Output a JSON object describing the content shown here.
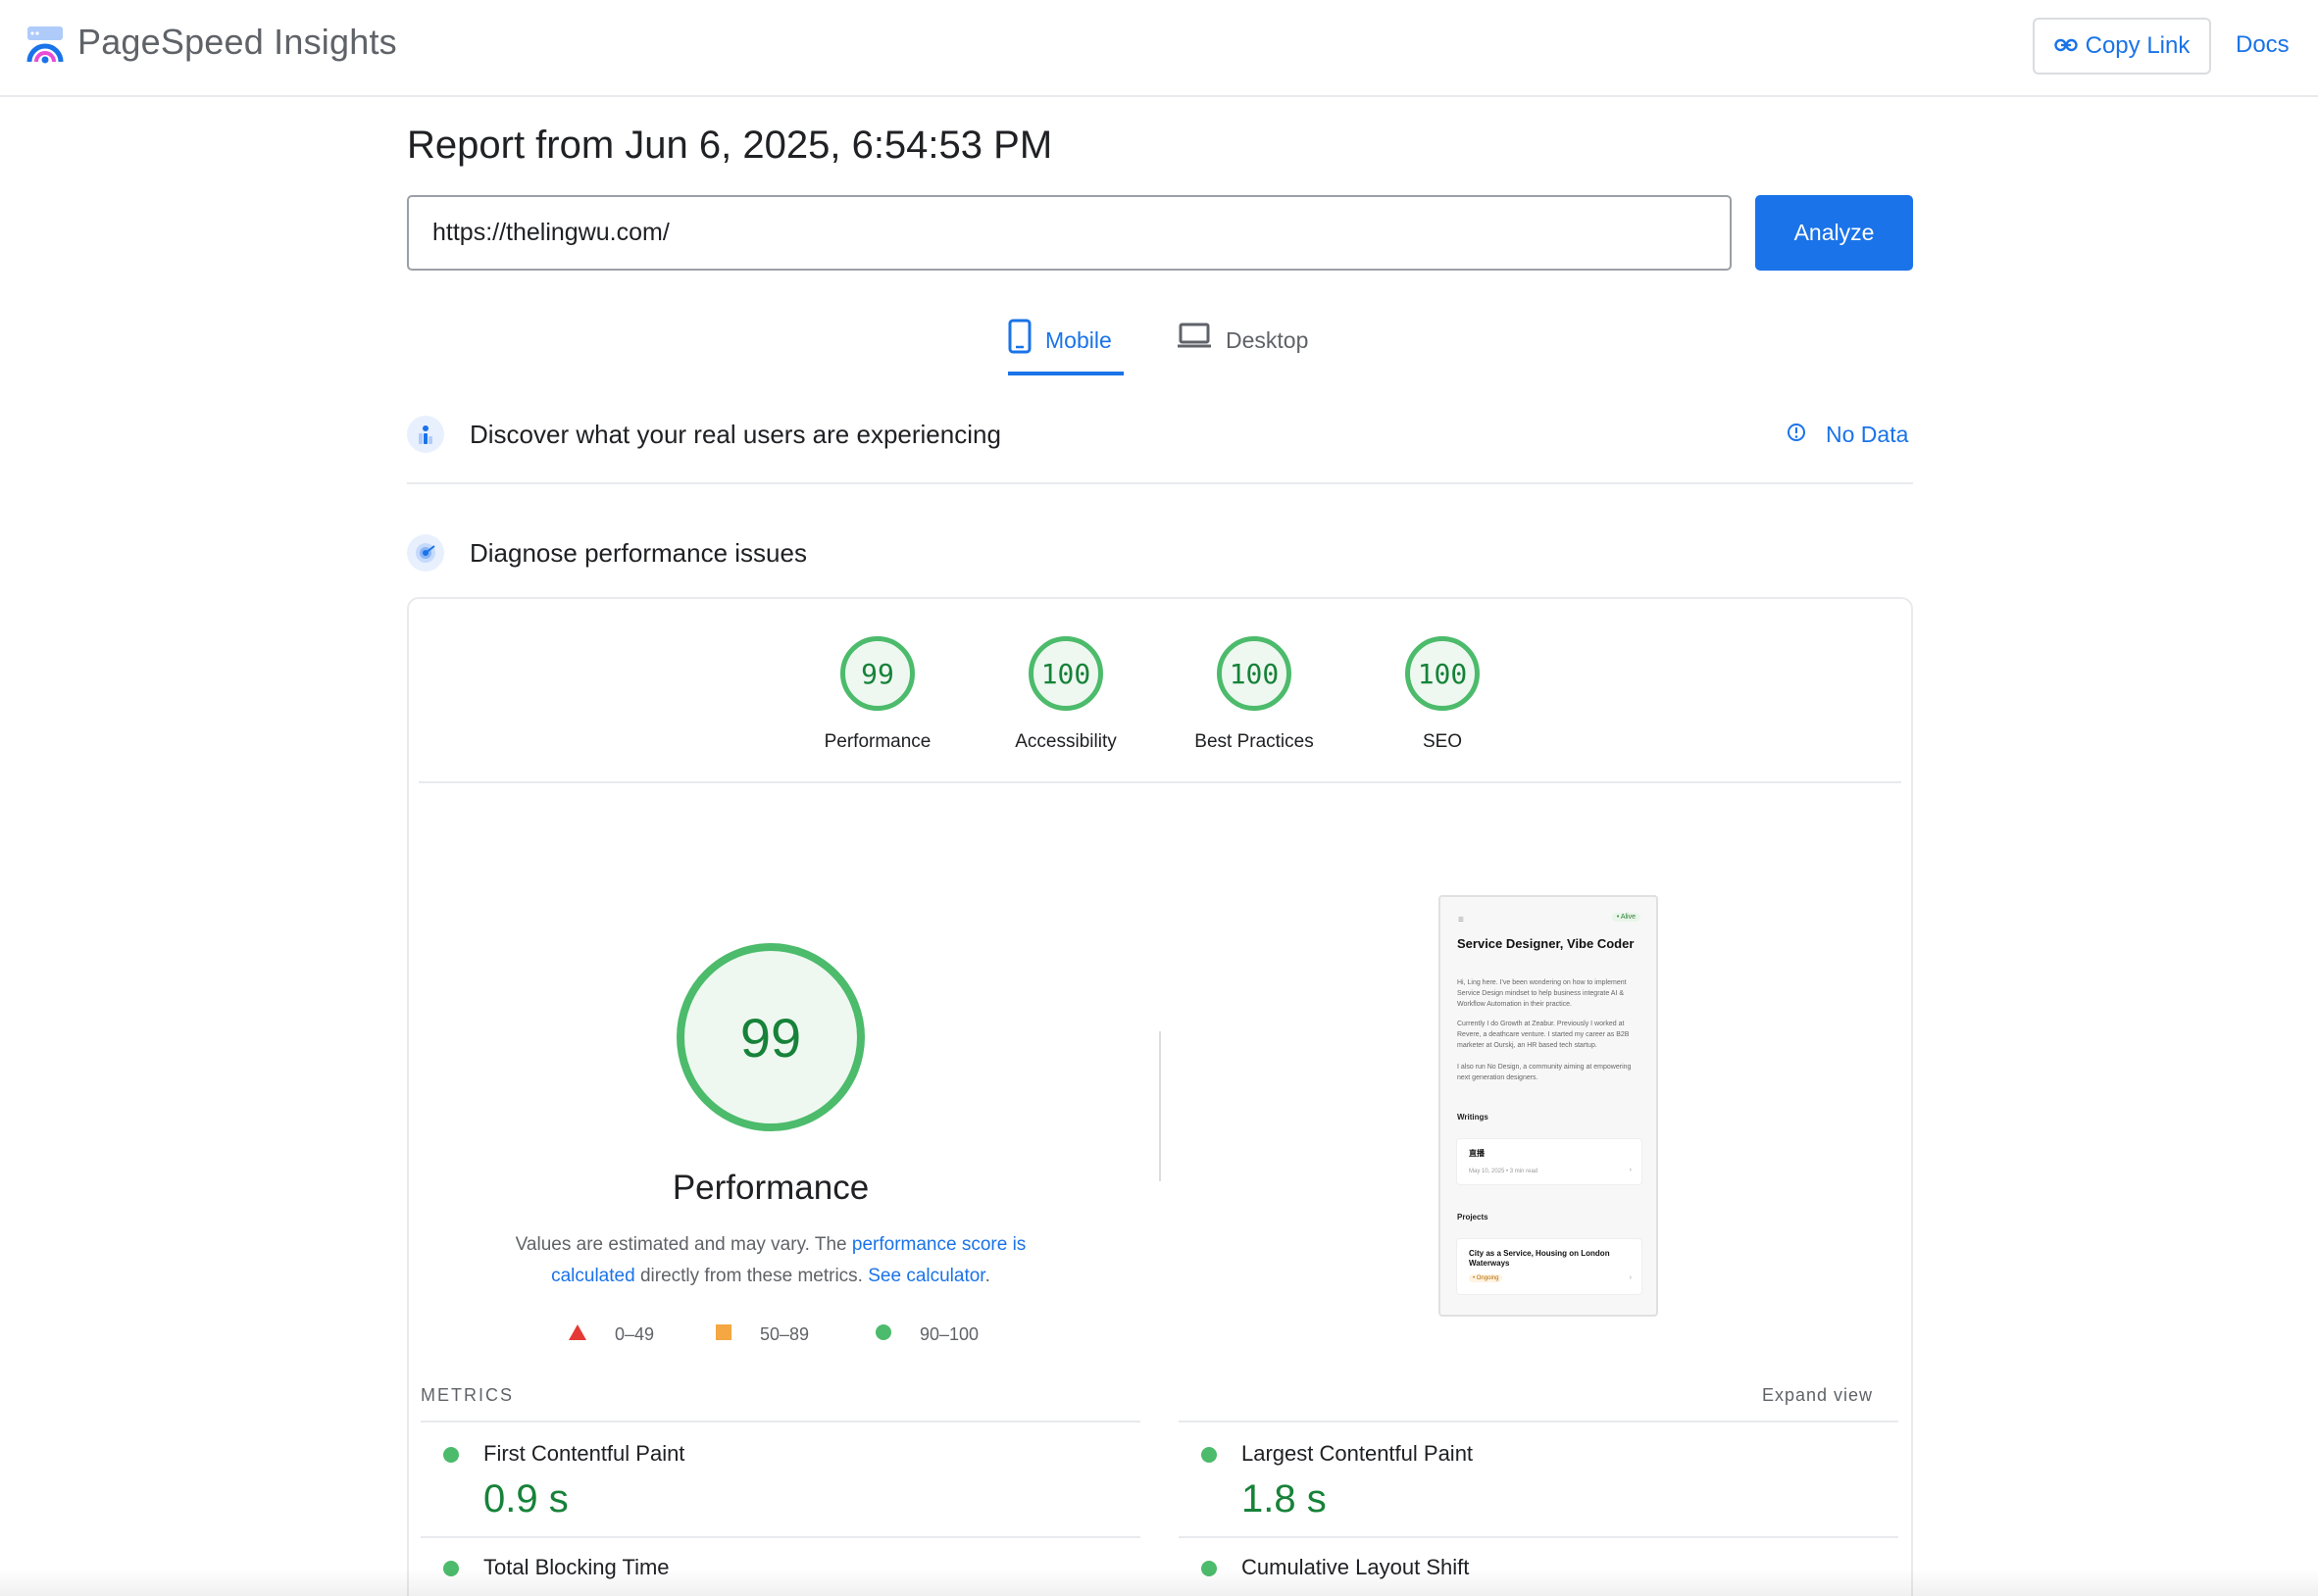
{
  "header": {
    "app_title": "PageSpeed Insights",
    "copy_link_label": "Copy Link",
    "docs_label": "Docs"
  },
  "report": {
    "title": "Report from Jun 6, 2025, 6:54:53 PM",
    "url_value": "https://thelingwu.com/",
    "analyze_label": "Analyze"
  },
  "tabs": [
    {
      "label": "Mobile",
      "active": true
    },
    {
      "label": "Desktop",
      "active": false
    }
  ],
  "sections": {
    "real_users_title": "Discover what your real users are experiencing",
    "no_data_label": "No Data",
    "diagnose_title": "Diagnose performance issues"
  },
  "scores": [
    {
      "value": "99",
      "label": "Performance"
    },
    {
      "value": "100",
      "label": "Accessibility"
    },
    {
      "value": "100",
      "label": "Best Practices"
    },
    {
      "value": "100",
      "label": "SEO"
    }
  ],
  "performance": {
    "score": "99",
    "title": "Performance",
    "desc_prefix": "Values are estimated and may vary. The ",
    "desc_link1": "performance score is calculated",
    "desc_middle": " directly from these metrics. ",
    "desc_link2": "See calculator",
    "desc_suffix": ".",
    "legend": [
      {
        "range": "0–49",
        "color": "#e53935"
      },
      {
        "range": "50–89",
        "color": "#f4a742"
      },
      {
        "range": "90–100",
        "color": "#4cbb6b"
      }
    ]
  },
  "thumbnail": {
    "badge": "• Alive",
    "title": "Service Designer, Vibe Coder",
    "para1": "Hi, Ling here. I've been wondering on how to implement Service Design mindset to help business integrate AI & Workflow Automation in their practice.",
    "para2": "Currently I do Growth at Zeabur. Previously I worked at Revere, a deathcare venture. I started my career as B2B marketer at Ourskj, an HR based tech startup.",
    "para3": "I also run No Design, a community aiming at empowering next generation designers.",
    "writings_h": "Writings",
    "writing_title": "直播",
    "writing_meta": "May 10, 2025 • 3 min read",
    "projects_h": "Projects",
    "project_title": "City as a Service, Housing on London Waterways",
    "project_tag": "• Ongoing"
  },
  "metrics": {
    "heading": "METRICS",
    "expand_label": "Expand view",
    "items": [
      {
        "name": "First Contentful Paint",
        "value": "0.9 s"
      },
      {
        "name": "Largest Contentful Paint",
        "value": "1.8 s"
      },
      {
        "name": "Total Blocking Time",
        "value": ""
      },
      {
        "name": "Cumulative Layout Shift",
        "value": ""
      }
    ]
  },
  "colors": {
    "accent": "#1a73e8",
    "good": "#4cbb6b",
    "good_text": "#178239"
  }
}
